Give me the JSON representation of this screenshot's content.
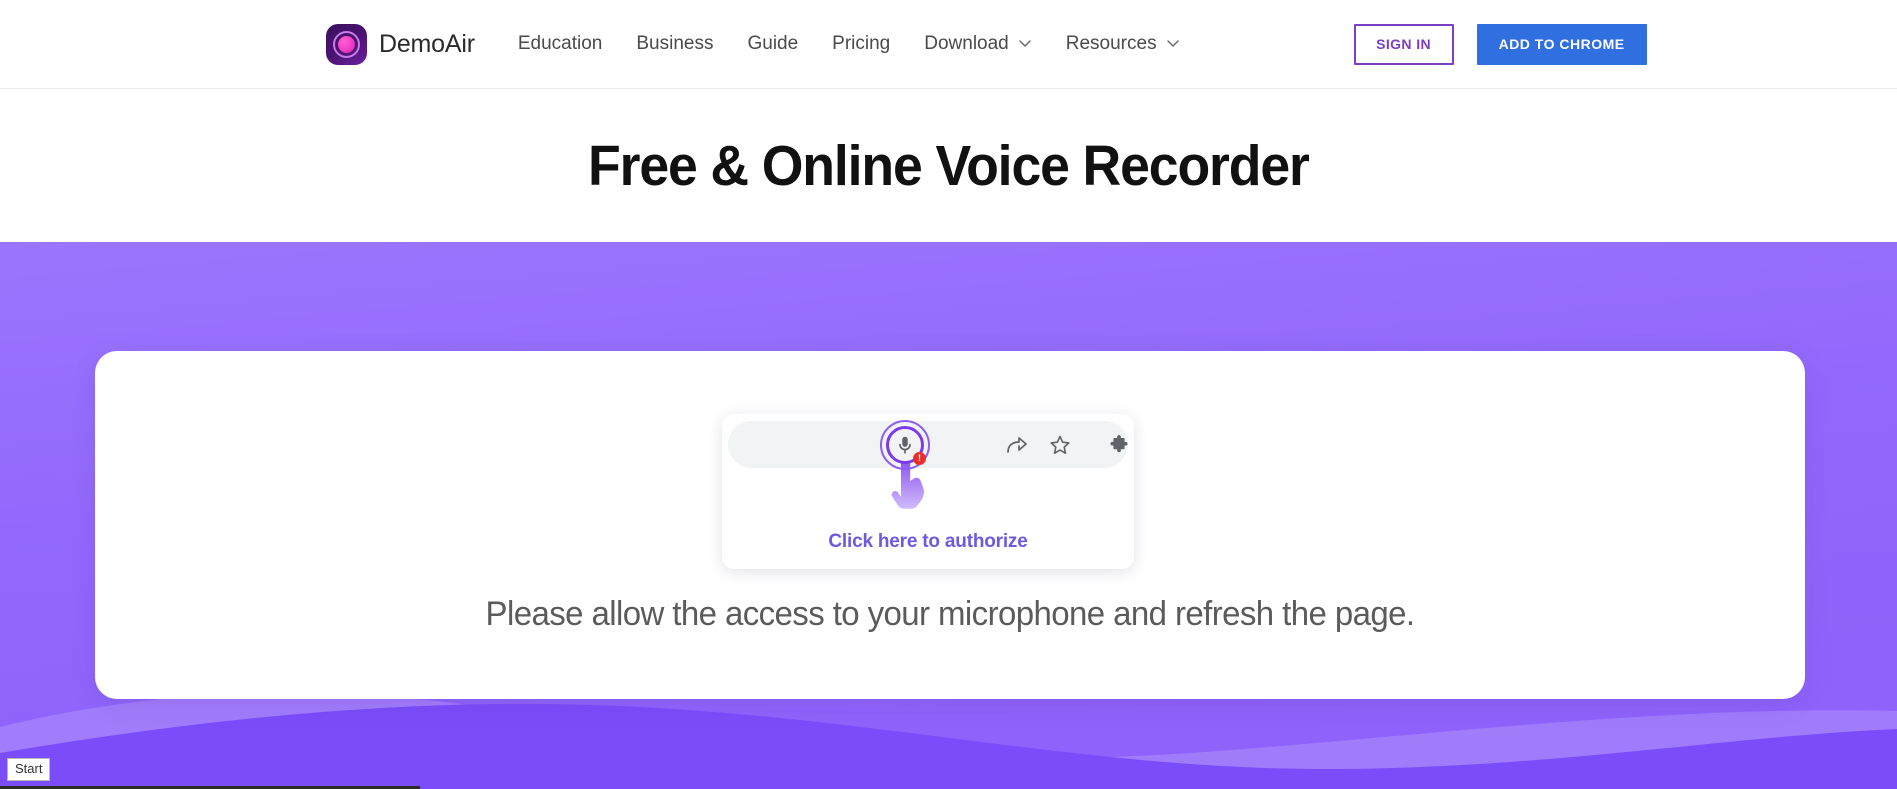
{
  "header": {
    "brand": {
      "name": "DemoAir",
      "logo_icon": "demoair-logo-icon"
    },
    "nav_items": [
      {
        "label": "Education",
        "has_dropdown": false
      },
      {
        "label": "Business",
        "has_dropdown": false
      },
      {
        "label": "Guide",
        "has_dropdown": false
      },
      {
        "label": "Pricing",
        "has_dropdown": false
      },
      {
        "label": "Download",
        "has_dropdown": true,
        "dropdown_icon": "chevron-down-icon"
      },
      {
        "label": "Resources",
        "has_dropdown": true,
        "dropdown_icon": "chevron-down-icon"
      }
    ],
    "sign_in_label": "SIGN IN",
    "add_to_chrome_label": "ADD TO CHROME"
  },
  "page": {
    "title": "Free & Online Voice Recorder"
  },
  "hero": {
    "background_color": "#9167fc",
    "wave_light_color": "#a98cfd",
    "wave_dark_color": "#7b4dfa"
  },
  "panel": {
    "popup": {
      "omnibox_background": "#f1f3f4",
      "mic_icon": "microphone-icon",
      "mic_badge_text": "!",
      "mic_badge_color": "#e8302a",
      "highlight_ring_color": "#7c3aed",
      "share_icon": "share-arrow-icon",
      "bookmark_icon": "star-outline-icon",
      "extensions_icon": "puzzle-piece-icon",
      "menu_icon": "three-dots-vertical-icon",
      "cursor_icon": "pointing-hand-icon",
      "authorize_text": "Click here to authorize",
      "authorize_text_color": "#6d5ae0"
    },
    "allow_message": "Please allow the access to your microphone and refresh the page."
  },
  "taskbar": {
    "start_label": "Start"
  },
  "colors": {
    "accent_purple": "#7b4dfa",
    "sign_in_purple": "#7b3fc4",
    "chrome_blue": "#2f6fe0",
    "title_black": "#111111",
    "body_gray": "#5b5b5b"
  }
}
